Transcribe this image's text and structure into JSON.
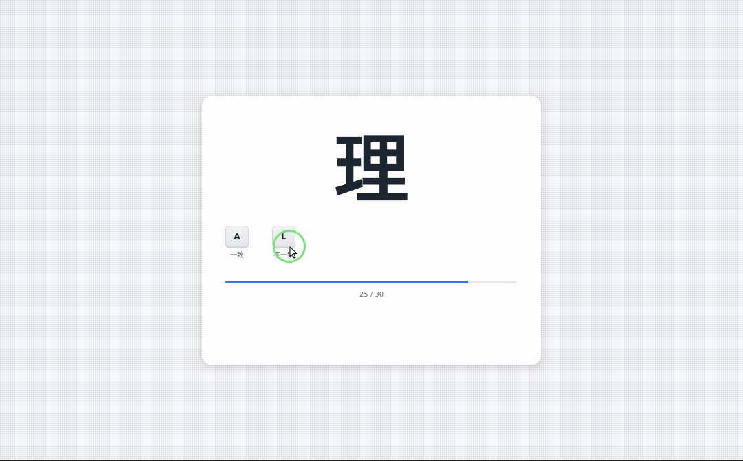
{
  "card": {
    "character": "理"
  },
  "keys": [
    {
      "key": "A",
      "caption": "一致"
    },
    {
      "key": "L",
      "caption": "不一致"
    }
  ],
  "progress": {
    "current": 25,
    "total": 30,
    "fraction": 0.8333,
    "text": "25 / 30"
  },
  "colors": {
    "progress_fill": "#3b75e0",
    "highlight_ring": "#7ee07c",
    "character": "#1d2530"
  },
  "icons": {
    "cursor": "mouse-pointer-icon"
  }
}
